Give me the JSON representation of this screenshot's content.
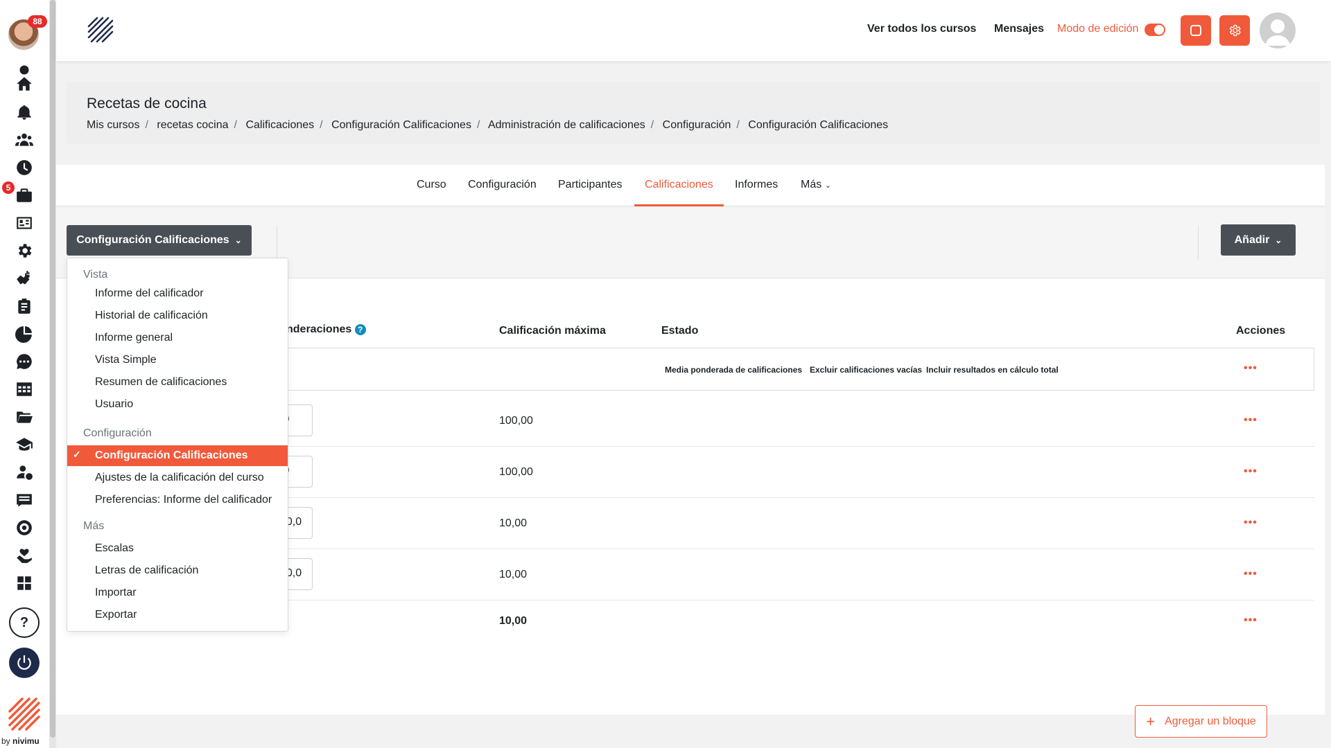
{
  "rail": {
    "notifications_badge": "88",
    "briefcase_badge": "5",
    "help_glyph": "?",
    "brand_by": "by",
    "brand_name": "nivimu",
    "icons": [
      "dot-icon",
      "home-icon",
      "bell-icon",
      "users-icon",
      "clock-icon",
      "briefcase-icon",
      "id-card-icon",
      "gear-icon",
      "handshake-dollar-icon",
      "clipboard-icon",
      "pie-chart-icon",
      "chat-icon",
      "table-icon",
      "folder-icon",
      "graduation-cap-icon",
      "user-money-icon",
      "list-icon",
      "target-icon",
      "heart-hands-icon",
      "grid-icon"
    ]
  },
  "topbar": {
    "all_courses": "Ver todos los cursos",
    "messages": "Mensajes",
    "edit_mode": "Modo de edición",
    "accent": "#f05a3a"
  },
  "header": {
    "title": "Recetas de cocina",
    "breadcrumb": [
      "Mis cursos",
      "recetas cocina",
      "Calificaciones",
      "Configuración Calificaciones",
      "Administración de calificaciones",
      "Configuración",
      "Configuración Calificaciones"
    ]
  },
  "tabs": [
    "Curso",
    "Configuración",
    "Participantes",
    "Calificaciones",
    "Informes",
    "Más"
  ],
  "active_tab": "Calificaciones",
  "actionbar": {
    "selector_label": "Configuración Calificaciones",
    "add_label": "Añadir"
  },
  "table": {
    "col_weights": "nderaciones",
    "col_max": "Calificación máxima",
    "col_status": "Estado",
    "col_actions": "Acciones",
    "status_chips": [
      "Media ponderada de calificaciones",
      "Excluir calificaciones vacías",
      "Incluir resultados en cálculo total"
    ],
    "rows": [
      {
        "weight": ",0",
        "max": "100,00"
      },
      {
        "weight": ",0",
        "max": "100,00"
      },
      {
        "weight": "70,0",
        "max": "10,00"
      },
      {
        "weight": "30,0",
        "max": "10,00"
      }
    ],
    "total_max": "10,00",
    "actions_glyph": "•••"
  },
  "dropdown": {
    "sections": [
      {
        "title": "Vista",
        "items": [
          "Informe del calificador",
          "Historial de calificación",
          "Informe general",
          "Vista Simple",
          "Resumen de calificaciones",
          "Usuario"
        ]
      },
      {
        "title": "Configuración",
        "items": [
          "Configuración Calificaciones",
          "Ajustes de la calificación del curso",
          "Preferencias: Informe del calificador"
        ]
      },
      {
        "title": "Más",
        "items": [
          "Escalas",
          "Letras de calificación",
          "Importar",
          "Exportar"
        ]
      }
    ],
    "selected": "Configuración Calificaciones"
  },
  "add_block": {
    "label": "Agregar un bloque",
    "icon": "plus-icon"
  }
}
